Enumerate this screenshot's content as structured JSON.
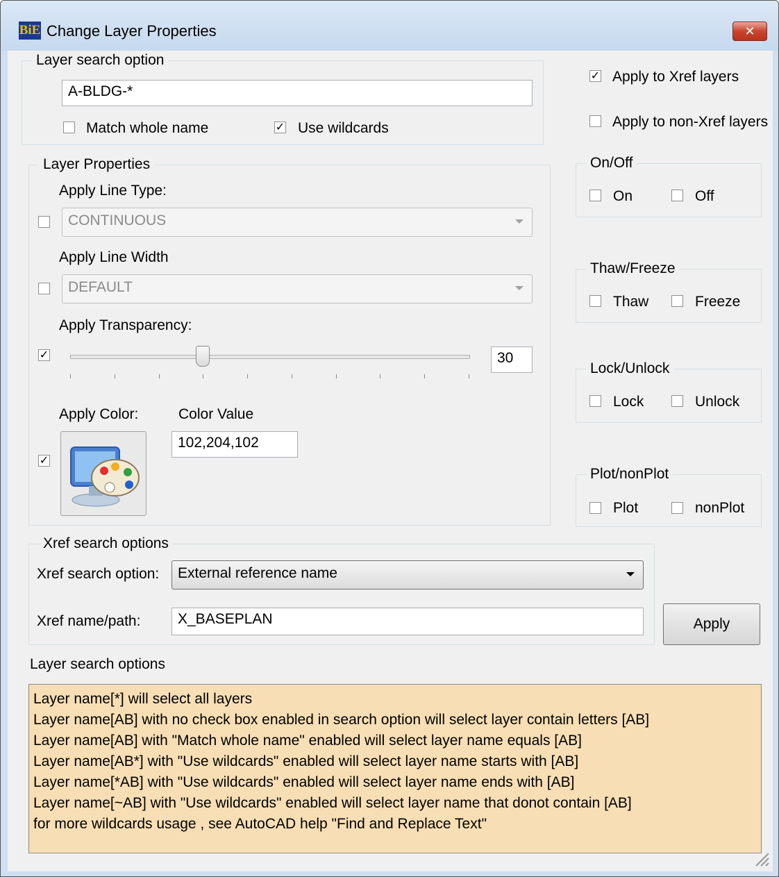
{
  "window": {
    "title": "Change Layer Properties",
    "icon": "BiE",
    "close_icon": "close-icon"
  },
  "layer_search": {
    "legend": "Layer search option",
    "value": "A-BLDG-*",
    "match_whole_name": {
      "label": "Match whole name",
      "checked": false
    },
    "use_wildcards": {
      "label": "Use wildcards",
      "checked": true
    }
  },
  "apply_xref_layers": {
    "label": "Apply to Xref layers",
    "checked": true
  },
  "apply_non_xref_layers": {
    "label": "Apply to non-Xref layers",
    "checked": false
  },
  "layer_properties": {
    "legend": "Layer Properties",
    "line_type": {
      "label": "Apply Line Type:",
      "value": "CONTINUOUS",
      "checked": false
    },
    "line_width": {
      "label": "Apply Line Width",
      "value": "DEFAULT",
      "checked": false
    },
    "transparency": {
      "label": "Apply Transparency:",
      "value": "30",
      "checked": true,
      "level": 30,
      "max": 90
    },
    "color": {
      "label": "Apply Color:",
      "value_label": "Color Value",
      "value": "102,204,102",
      "checked": true
    }
  },
  "on_off": {
    "legend": "On/Off",
    "on": "On",
    "off": "Off"
  },
  "thaw_freeze": {
    "legend": "Thaw/Freeze",
    "thaw": "Thaw",
    "freeze": "Freeze"
  },
  "lock_unlock": {
    "legend": "Lock/Unlock",
    "lock": "Lock",
    "unlock": "Unlock"
  },
  "plot_noplot": {
    "legend": "Plot/nonPlot",
    "plot": "Plot",
    "noplot": "nonPlot"
  },
  "xref_search": {
    "legend": "Xref search options",
    "option_label": "Xref search option:",
    "option_value": "External reference name",
    "name_label": "Xref name/path:",
    "name_value": "X_BASEPLAN"
  },
  "apply_button": "Apply",
  "help": {
    "heading": "Layer search options",
    "lines": [
      "Layer name[*]  will select all layers",
      "Layer name[AB] with no check box enabled in search option will select  layer contain letters [AB]",
      "Layer name[AB] with \"Match whole name\" enabled will select  layer name equals [AB]",
      "Layer name[AB*] with \"Use wildcards\" enabled will select layer name starts with [AB]",
      "Layer name[*AB] with \"Use wildcards\" enabled will select layer name ends with [AB]",
      "Layer name[~AB] with \"Use wildcards\" enabled will select layer name that donot contain [AB]",
      "for more wildcards usage , see AutoCAD help  \"Find and Replace Text\""
    ]
  }
}
